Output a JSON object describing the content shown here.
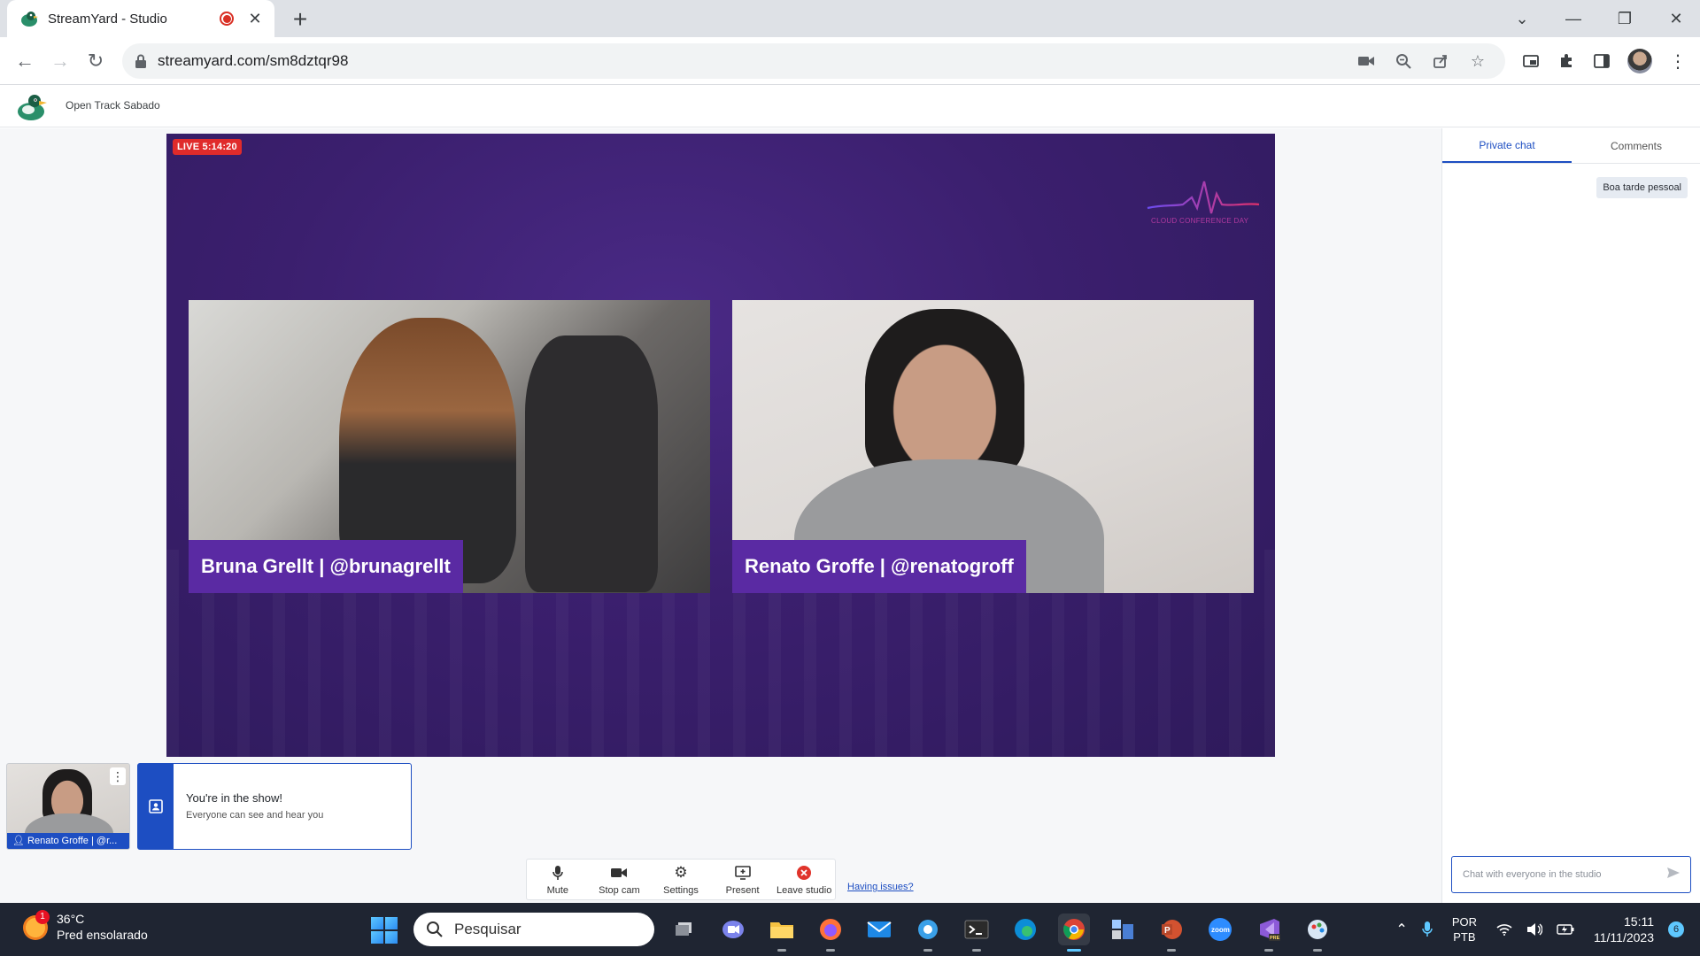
{
  "browser": {
    "tab_title": "StreamYard - Studio",
    "url": "streamyard.com/sm8dztqr98"
  },
  "app": {
    "broadcast_name": "Open Track Sabado",
    "live_badge": "LIVE 5:14:20",
    "event_logo_text": "CLOUD CONFERENCE DAY"
  },
  "stage": {
    "participants": [
      {
        "name": "Bruna Grellt | @brunagrellt"
      },
      {
        "name": "Renato Groffe | @renatogroff"
      }
    ]
  },
  "self_view": {
    "label": "Renato Groffe | @r..."
  },
  "notice": {
    "title": "You're in the show!",
    "subtitle": "Everyone can see and hear you"
  },
  "controls": {
    "mute": "Mute",
    "stop_cam": "Stop cam",
    "settings": "Settings",
    "present": "Present",
    "leave": "Leave studio",
    "having_issues": "Having issues?"
  },
  "chat": {
    "tabs": [
      "Private chat",
      "Comments"
    ],
    "active_tab": "Private chat",
    "messages": [
      "Boa tarde pessoal"
    ],
    "input_placeholder": "Chat with everyone in the studio"
  },
  "taskbar": {
    "weather_temp": "36°C",
    "weather_desc": "Pred ensolarado",
    "weather_badge": "1",
    "search_label": "Pesquisar",
    "language": "POR",
    "layout": "PTB",
    "time": "15:11",
    "date": "11/11/2023",
    "notification_count": "6"
  },
  "colors": {
    "stage_purple": "#3b1f6e",
    "nameplate_purple": "#5a2aa3",
    "accent_blue": "#1d4ec2",
    "live_red": "#e02b2b"
  }
}
